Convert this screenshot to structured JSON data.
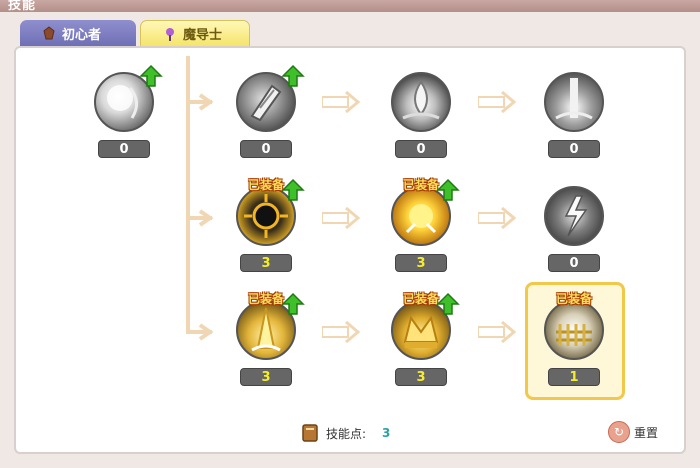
{
  "window": {
    "title": "技能"
  },
  "tabs": [
    {
      "label": "初心者",
      "active": false
    },
    {
      "label": "魔导士",
      "active": true
    }
  ],
  "skills": {
    "root": {
      "level": "0",
      "upgrade": true,
      "icon": "silver-orb-icon"
    },
    "row1": [
      {
        "level": "0",
        "upgrade": true,
        "icon": "crystal-shard-icon"
      },
      {
        "level": "0",
        "upgrade": false,
        "icon": "water-drop-icon"
      },
      {
        "level": "0",
        "upgrade": false,
        "icon": "light-pillar-icon"
      }
    ],
    "row2": [
      {
        "level": "3",
        "upgrade": true,
        "equipped": "已装备",
        "icon": "dark-sun-icon"
      },
      {
        "level": "3",
        "upgrade": true,
        "equipped": "已装备",
        "icon": "bright-sun-icon"
      },
      {
        "level": "0",
        "upgrade": false,
        "icon": "lightning-icon"
      }
    ],
    "row3": [
      {
        "level": "3",
        "upgrade": true,
        "equipped": "已装备",
        "icon": "golden-spike-icon"
      },
      {
        "level": "3",
        "upgrade": true,
        "equipped": "已装备",
        "icon": "golden-crown-icon"
      },
      {
        "level": "1",
        "upgrade": false,
        "equipped": "已装备",
        "icon": "golden-fence-icon"
      }
    ]
  },
  "footer": {
    "skill_points_label": "技能点:",
    "skill_points_value": "3",
    "reset_label": "重置"
  },
  "colors": {
    "accent_yellow": "#f5ee2e",
    "arrow": "#f1d6b4",
    "highlight_border": "#f1c84a",
    "upgrade_green": "#3fbf2a"
  }
}
